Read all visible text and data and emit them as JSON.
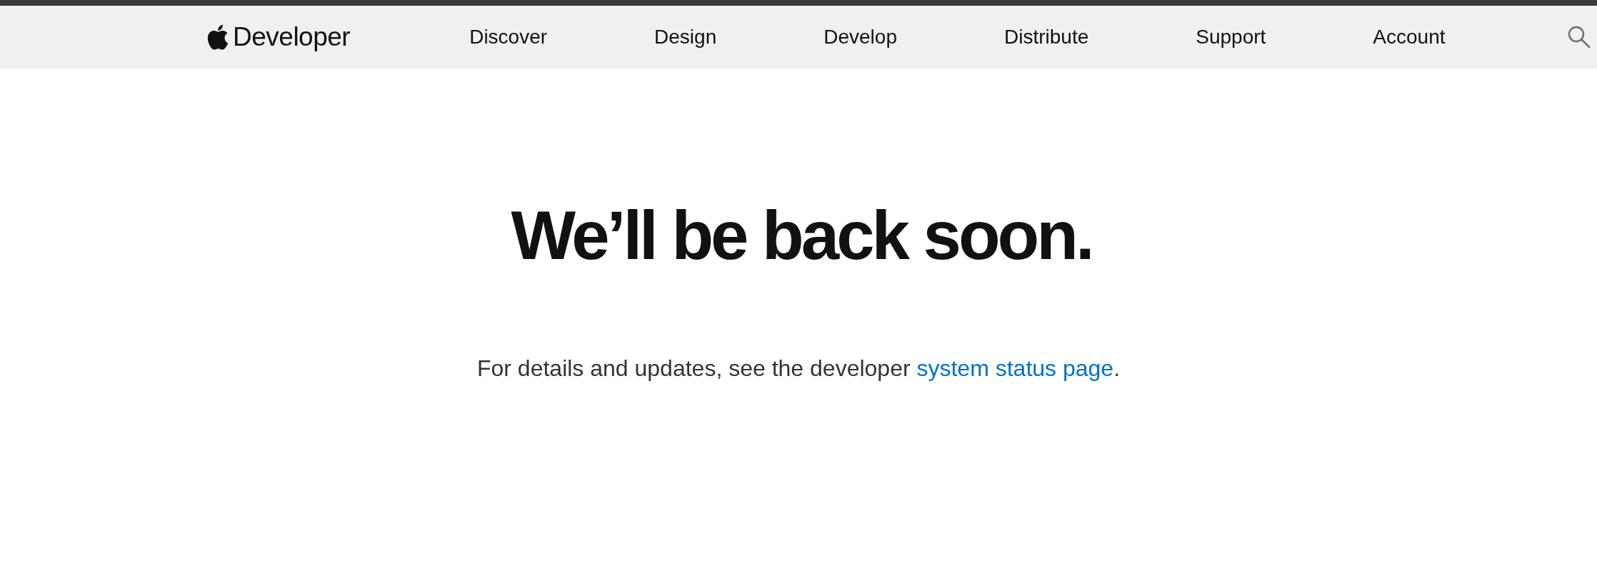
{
  "header": {
    "logo_text": "Developer",
    "nav": [
      {
        "label": "Discover"
      },
      {
        "label": "Design"
      },
      {
        "label": "Develop"
      },
      {
        "label": "Distribute"
      },
      {
        "label": "Support"
      },
      {
        "label": "Account"
      }
    ]
  },
  "main": {
    "heading": "We’ll be back soon.",
    "message": {
      "before": "For details and updates, see the developer ",
      "link": "system status page",
      "after": "."
    }
  }
}
